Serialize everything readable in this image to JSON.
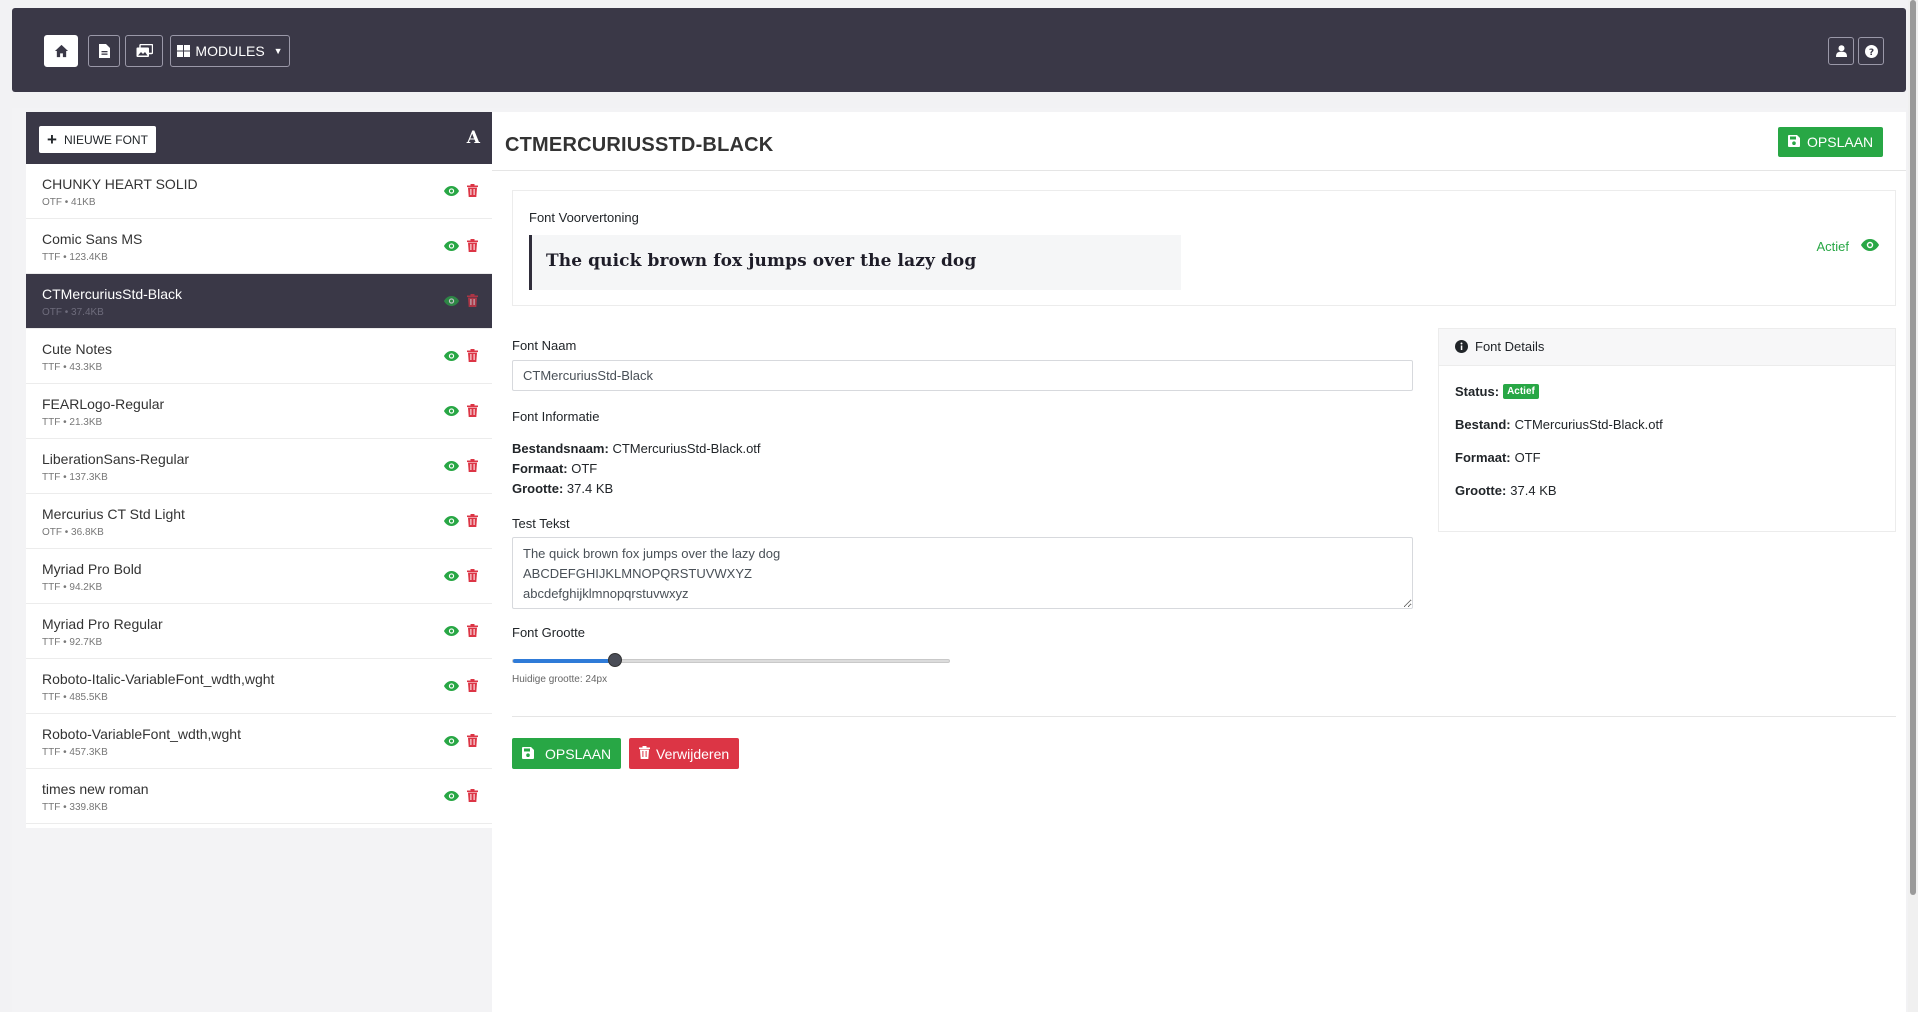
{
  "topbar": {
    "modules_label": "MODULES"
  },
  "sidebar": {
    "new_font_label": "NIEUWE FONT",
    "sort_icon_text": "A",
    "fonts": [
      {
        "name": "CHUNKY HEART SOLID",
        "meta": "OTF • 41KB",
        "selected": false
      },
      {
        "name": "Comic Sans MS",
        "meta": "TTF • 123.4KB",
        "selected": false
      },
      {
        "name": "CTMercuriusStd-Black",
        "meta": "OTF • 37.4KB",
        "selected": true
      },
      {
        "name": "Cute Notes",
        "meta": "TTF • 43.3KB",
        "selected": false
      },
      {
        "name": "FEARLogo-Regular",
        "meta": "TTF • 21.3KB",
        "selected": false
      },
      {
        "name": "LiberationSans-Regular",
        "meta": "TTF • 137.3KB",
        "selected": false
      },
      {
        "name": "Mercurius CT Std Light",
        "meta": "OTF • 36.8KB",
        "selected": false
      },
      {
        "name": "Myriad Pro Bold",
        "meta": "TTF • 94.2KB",
        "selected": false
      },
      {
        "name": "Myriad Pro Regular",
        "meta": "TTF • 92.7KB",
        "selected": false
      },
      {
        "name": "Roboto-Italic-VariableFont_wdth,wght",
        "meta": "TTF • 485.5KB",
        "selected": false
      },
      {
        "name": "Roboto-VariableFont_wdth,wght",
        "meta": "TTF • 457.3KB",
        "selected": false
      },
      {
        "name": "times new roman",
        "meta": "TTF • 339.8KB",
        "selected": false
      }
    ]
  },
  "editor": {
    "title": "CTMERCURIUSSTD-BLACK",
    "save_label": "OPSLAAN",
    "preview": {
      "label": "Font Voorvertoning",
      "text": "The quick brown fox jumps over the lazy dog",
      "status": "Actief"
    },
    "name_label": "Font Naam",
    "name_value": "CTMercuriusStd-Black",
    "info_label": "Font Informatie",
    "info": {
      "filename_key": "Bestandsnaam:",
      "filename_value": "CTMercuriusStd-Black.otf",
      "format_key": "Formaat:",
      "format_value": "OTF",
      "size_key": "Grootte:",
      "size_value": "37.4 KB"
    },
    "test_label": "Test Tekst",
    "test_text": "The quick brown fox jumps over the lazy dog\nABCDEFGHIJKLMNOPQRSTUVWXYZ\nabcdefghijklmnopqrstuvwxyz",
    "size_label": "Font Grootte",
    "size_hint": "Huidige grootte: 24px",
    "slider_fraction": 0.235,
    "save_bottom_label": "OPSLAAN",
    "delete_label": "Verwijderen"
  },
  "details": {
    "title": "Font Details",
    "status_key": "Status:",
    "status_value": "Actief",
    "file_key": "Bestand:",
    "file_value": "CTMercuriusStd-Black.otf",
    "format_key": "Formaat:",
    "format_value": "OTF",
    "size_key": "Grootte:",
    "size_value": "37.4 KB"
  },
  "colors": {
    "dark": "#3a3847",
    "green": "#28a745",
    "red": "#dc3545",
    "blue": "#2f7bd8"
  }
}
